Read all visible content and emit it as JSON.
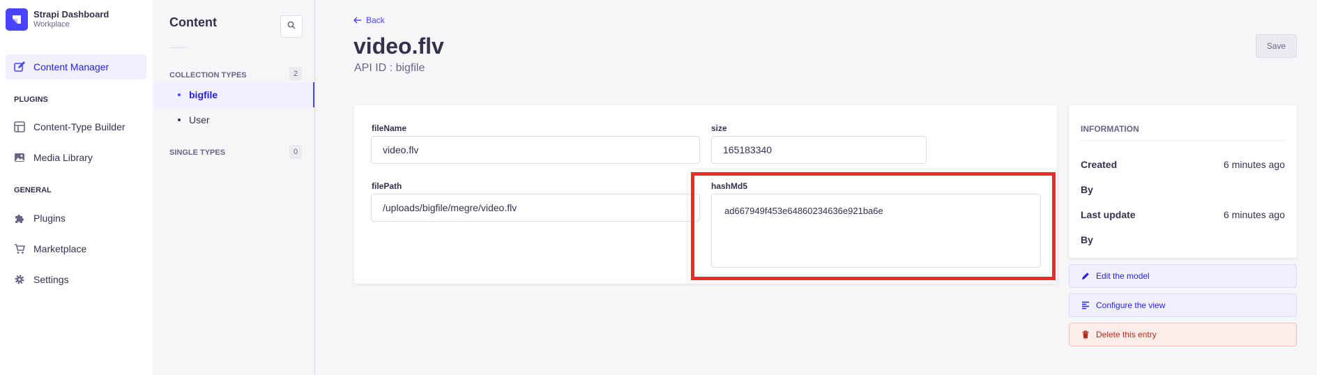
{
  "brand": {
    "title": "Strapi Dashboard",
    "subtitle": "Workplace"
  },
  "sidebar": {
    "active_item": {
      "label": "Content Manager",
      "icon": "content-manager-icon"
    },
    "plugins_heading": "PLUGINS",
    "plugins": [
      {
        "label": "Content-Type Builder",
        "icon": "layout-icon"
      },
      {
        "label": "Media Library",
        "icon": "image-icon"
      }
    ],
    "general_heading": "GENERAL",
    "general": [
      {
        "label": "Plugins",
        "icon": "puzzle-icon"
      },
      {
        "label": "Marketplace",
        "icon": "cart-icon"
      },
      {
        "label": "Settings",
        "icon": "gear-icon"
      }
    ]
  },
  "subnav": {
    "title": "Content",
    "collection_heading": "COLLECTION TYPES",
    "collection_count": "2",
    "collection_items": [
      "bigfile",
      "User"
    ],
    "single_heading": "SINGLE TYPES",
    "single_count": "0"
  },
  "header": {
    "back_label": "Back",
    "title": "video.flv",
    "subtitle": "API ID : bigfile",
    "save_label": "Save"
  },
  "form": {
    "fileName": {
      "label": "fileName",
      "value": "video.flv"
    },
    "size": {
      "label": "size",
      "value": "165183340"
    },
    "filePath": {
      "label": "filePath",
      "value": "/uploads/bigfile/megre/video.flv"
    },
    "hashMd5": {
      "label": "hashMd5",
      "value": "ad667949f453e64860234636e921ba6e"
    }
  },
  "info": {
    "heading": "INFORMATION",
    "created_label": "Created",
    "created_value": "6 minutes ago",
    "by_label_1": "By",
    "updated_label": "Last update",
    "updated_value": "6 minutes ago",
    "by_label_2": "By"
  },
  "actions": {
    "edit_model": "Edit the model",
    "configure_view": "Configure the view",
    "delete_entry": "Delete this entry"
  },
  "colors": {
    "primary": "#4945ff",
    "highlight": "#ee2b2b",
    "danger": "#b72b1a"
  }
}
